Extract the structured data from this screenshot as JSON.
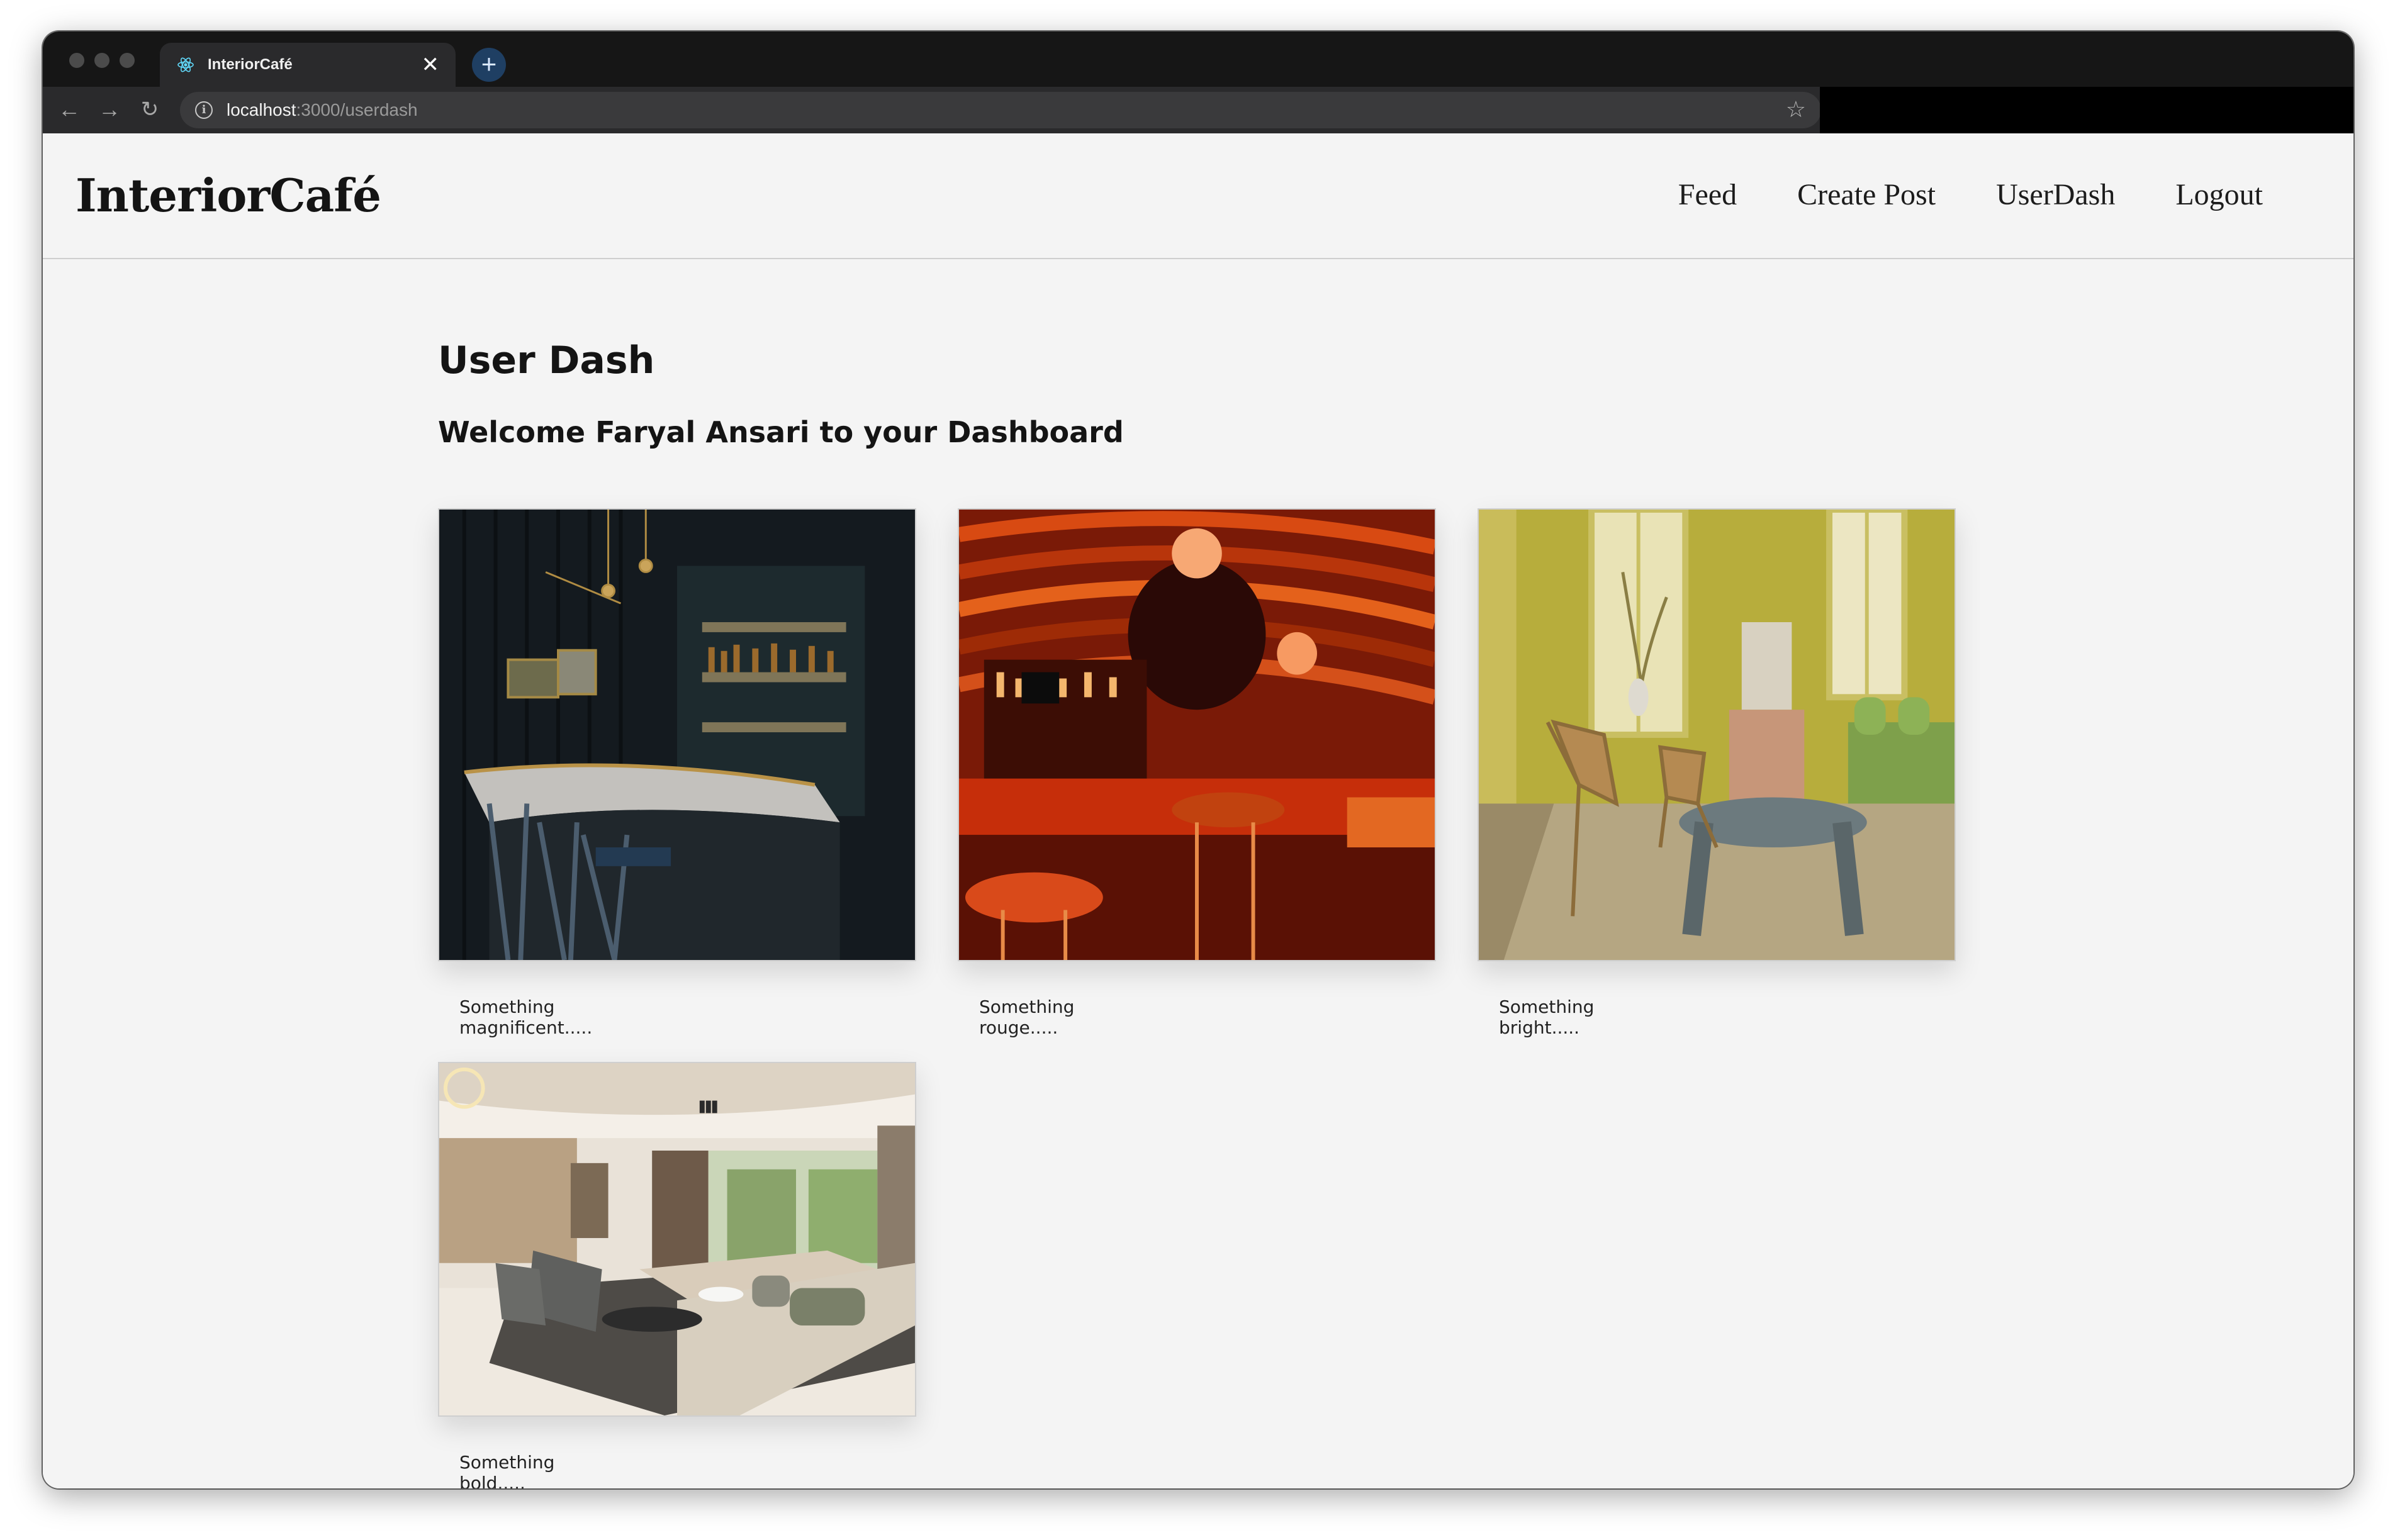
{
  "browser": {
    "tab_title": "InteriorCafé",
    "new_tab_symbol": "+",
    "close_symbol": "✕",
    "url_host": "localhost",
    "url_path": ":3000/userdash"
  },
  "site": {
    "logo": "InteriorCafé",
    "nav": {
      "feed": "Feed",
      "create_post": "Create Post",
      "userdash": "UserDash",
      "logout": "Logout"
    }
  },
  "main": {
    "title": "User Dash",
    "welcome": "Welcome Faryal Ansari to your Dashboard",
    "posts": [
      {
        "caption": "Something magnificent....."
      },
      {
        "caption": "Something rouge....."
      },
      {
        "caption": "Something bright....."
      },
      {
        "caption": "Something bold....."
      }
    ]
  }
}
